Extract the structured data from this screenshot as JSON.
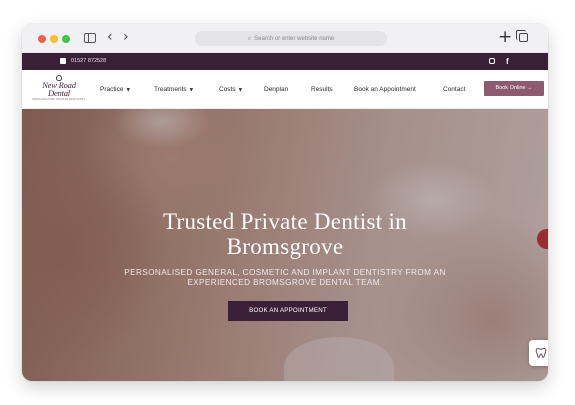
{
  "browser": {
    "address_placeholder": "Search or enter website name",
    "icons": [
      "close-dot",
      "minimize-dot",
      "maximize-dot",
      "sidebar-icon",
      "back-icon",
      "forward-icon",
      "search-icon",
      "new-tab-icon",
      "tabs-icon"
    ]
  },
  "topbar": {
    "phone": "01527 872528",
    "phone_icon": "phone-icon",
    "social": [
      "instagram-icon",
      "facebook-icon"
    ],
    "facebook_glyph": "f",
    "color": "#3b1f36"
  },
  "logo": {
    "name_line1": "New Road",
    "name_line2": "Dental",
    "tagline": "PERSONALISED PRIVATE DENTISTRY"
  },
  "nav": {
    "items": [
      {
        "label": "Practice",
        "dropdown": true
      },
      {
        "label": "Treatments",
        "dropdown": true
      },
      {
        "label": "Costs",
        "dropdown": true
      },
      {
        "label": "Denplan",
        "dropdown": false
      },
      {
        "label": "Results",
        "dropdown": false
      },
      {
        "label": "Book an Appointment",
        "dropdown": false
      },
      {
        "label": "Contact",
        "dropdown": false
      }
    ],
    "book_online": "Book Online",
    "book_online_color": "#8e5a6f"
  },
  "hero": {
    "title_line1": "Trusted Private Dentist in",
    "title_line2": "Bromsgrove",
    "subtitle_line1": "PERSONALISED GENERAL, COSMETIC AND IMPLANT DENTISTRY FROM AN",
    "subtitle_line2": "EXPERIENCED BROMSGROVE DENTAL TEAM.",
    "cta": "BOOK AN APPOINTMENT",
    "cta_color": "#3b1f36"
  },
  "widget": {
    "icon": "tooth-icon"
  }
}
